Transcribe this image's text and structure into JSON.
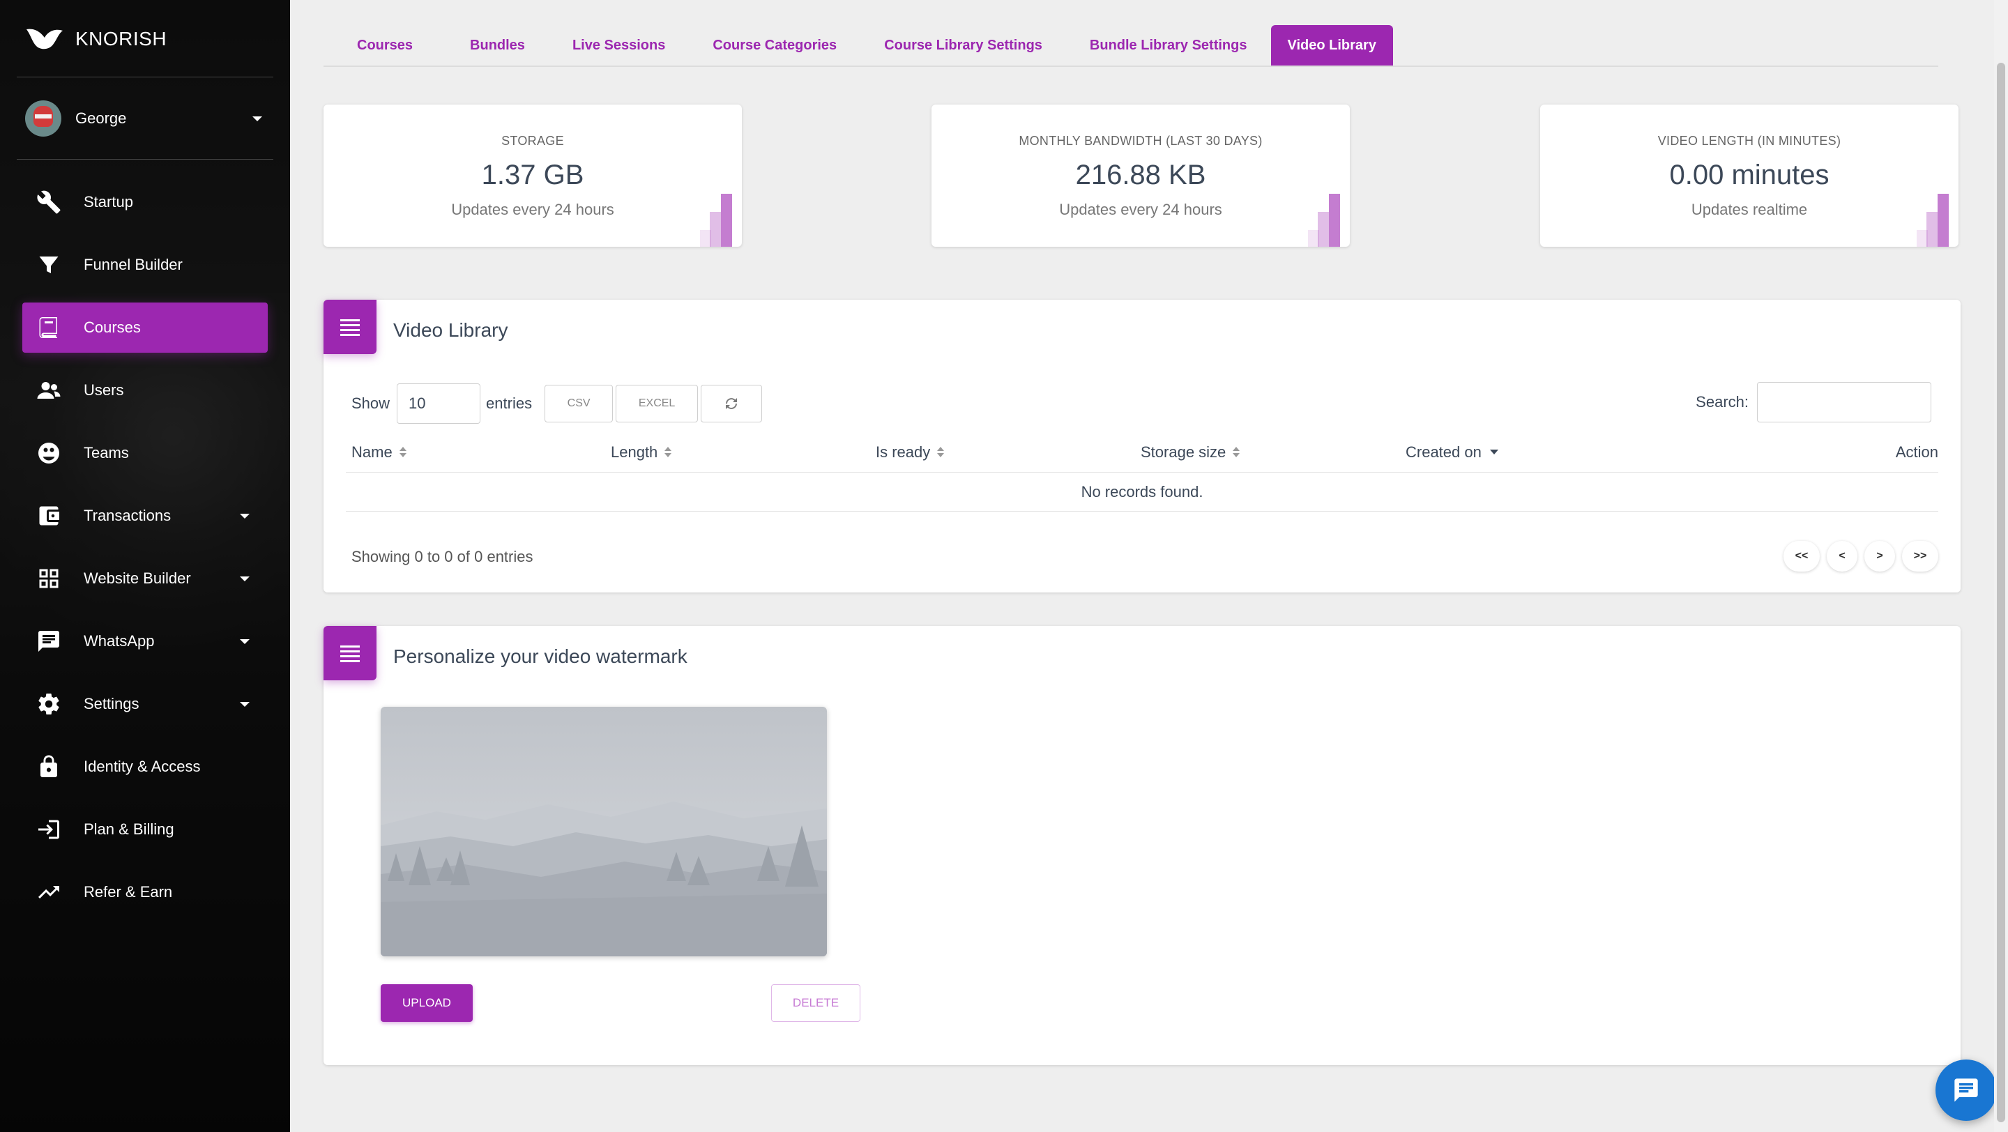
{
  "brand": {
    "name": "KNORISH"
  },
  "user": {
    "name": "George"
  },
  "sidebar": {
    "items": [
      {
        "label": "Startup",
        "icon": "wrench-icon"
      },
      {
        "label": "Funnel Builder",
        "icon": "funnel-icon"
      },
      {
        "label": "Courses",
        "icon": "book-icon",
        "active": true
      },
      {
        "label": "Users",
        "icon": "users-icon"
      },
      {
        "label": "Teams",
        "icon": "teams-icon"
      },
      {
        "label": "Transactions",
        "icon": "wallet-icon",
        "has_submenu": true
      },
      {
        "label": "Website Builder",
        "icon": "widgets-icon",
        "has_submenu": true
      },
      {
        "label": "WhatsApp",
        "icon": "chat-icon",
        "has_submenu": true
      },
      {
        "label": "Settings",
        "icon": "gear-icon",
        "has_submenu": true
      },
      {
        "label": "Identity & Access",
        "icon": "lock-icon"
      },
      {
        "label": "Plan & Billing",
        "icon": "login-icon"
      },
      {
        "label": "Refer & Earn",
        "icon": "trending-up-icon"
      }
    ]
  },
  "tabs": [
    {
      "label": "Courses"
    },
    {
      "label": "Bundles"
    },
    {
      "label": "Live Sessions"
    },
    {
      "label": "Course Categories"
    },
    {
      "label": "Course Library Settings"
    },
    {
      "label": "Bundle Library Settings"
    },
    {
      "label": "Video Library",
      "active": true
    }
  ],
  "stats": [
    {
      "title": "STORAGE",
      "value": "1.37 GB",
      "sub": "Updates every 24 hours"
    },
    {
      "title": "MONTHLY BANDWIDTH (LAST 30 DAYS)",
      "value": "216.88 KB",
      "sub": "Updates every 24 hours"
    },
    {
      "title": "VIDEO LENGTH (IN MINUTES)",
      "value": "0.00 minutes",
      "sub": "Updates realtime"
    }
  ],
  "video_library": {
    "title": "Video Library",
    "show_label": "Show",
    "entries_value": "10",
    "entries_label": "entries",
    "csv_label": "CSV",
    "excel_label": "EXCEL",
    "search_label": "Search:",
    "columns": [
      "Name",
      "Length",
      "Is ready",
      "Storage size",
      "Created on",
      "Action"
    ],
    "empty_text": "No records found.",
    "info_text": "Showing 0 to 0 of 0 entries",
    "pager": [
      "<<",
      "<",
      ">",
      ">>"
    ]
  },
  "watermark": {
    "title": "Personalize your video watermark",
    "upload_label": "UPLOAD",
    "delete_label": "DELETE"
  },
  "colors": {
    "accent": "#9c27b0",
    "fab": "#1976d2"
  }
}
